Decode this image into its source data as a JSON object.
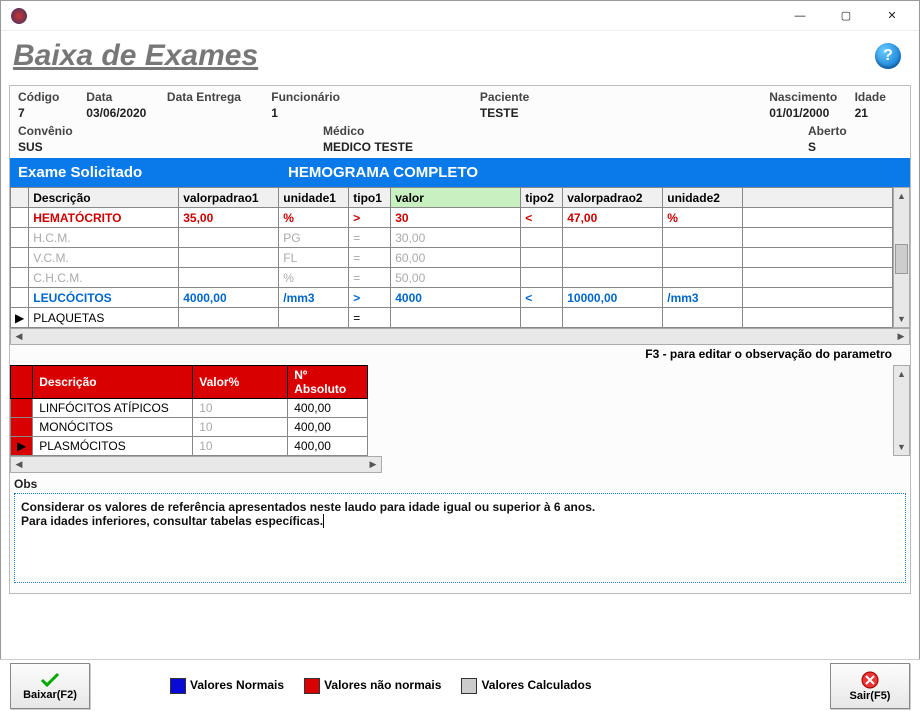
{
  "window": {
    "title": "Baixa de Exames"
  },
  "info": {
    "codigo_label": "Código",
    "codigo": "7",
    "data_label": "Data",
    "data": "03/06/2020",
    "entrega_label": "Data Entrega",
    "entrega": "",
    "funcionario_label": "Funcionário",
    "funcionario": "1",
    "paciente_label": "Paciente",
    "paciente": "TESTE",
    "nascimento_label": "Nascimento",
    "nascimento": "01/01/2000",
    "idade_label": "Idade",
    "idade": "21",
    "convenio_label": "Convênio",
    "convenio": "SUS",
    "medico_label": "Médico",
    "medico": "MEDICO TESTE",
    "aberto_label": "Aberto",
    "aberto": "S"
  },
  "exame": {
    "title": "Exame Solicitado",
    "name": "HEMOGRAMA COMPLETO",
    "headers": {
      "descricao": "Descrição",
      "vp1": "valorpadrao1",
      "u1": "unidade1",
      "t1": "tipo1",
      "valor": "valor",
      "t2": "tipo2",
      "vp2": "valorpadrao2",
      "u2": "unidade2"
    },
    "rows": [
      {
        "desc": "HEMATÓCRITO",
        "vp1": "35,00",
        "u1": "%",
        "t1": ">",
        "valor": "30",
        "t2": "<",
        "vp2": "47,00",
        "u2": "%",
        "cls": "c-red"
      },
      {
        "desc": "H.C.M.",
        "vp1": "",
        "u1": "PG",
        "t1": "=",
        "valor": "30,00",
        "t2": "",
        "vp2": "",
        "u2": "",
        "cls": "c-gray"
      },
      {
        "desc": "V.C.M.",
        "vp1": "",
        "u1": "FL",
        "t1": "=",
        "valor": "60,00",
        "t2": "",
        "vp2": "",
        "u2": "",
        "cls": "c-gray"
      },
      {
        "desc": "C.H.C.M.",
        "vp1": "",
        "u1": "%",
        "t1": "=",
        "valor": "50,00",
        "t2": "",
        "vp2": "",
        "u2": "",
        "cls": "c-gray"
      },
      {
        "desc": "LEUCÓCITOS",
        "vp1": "4000,00",
        "u1": "/mm3",
        "t1": ">",
        "valor": "4000",
        "t2": "<",
        "vp2": "10000,00",
        "u2": "/mm3",
        "cls": "c-blue"
      },
      {
        "desc": "PLAQUETAS",
        "vp1": "",
        "u1": "",
        "t1": "=",
        "valor": "",
        "t2": "",
        "vp2": "",
        "u2": "",
        "cls": ""
      }
    ]
  },
  "hint": "F3 - para editar o observação do parametro",
  "sub": {
    "headers": {
      "desc": "Descrição",
      "valpct": "Valor%",
      "nabs": "Nº Absoluto"
    },
    "rows": [
      {
        "desc": "LINFÓCITOS ATÍPICOS",
        "valpct": "10",
        "nabs": "400,00"
      },
      {
        "desc": "MONÓCITOS",
        "valpct": "10",
        "nabs": "400,00"
      },
      {
        "desc": "PLASMÓCITOS",
        "valpct": "10",
        "nabs": "400,00"
      }
    ]
  },
  "obs": {
    "label": "Obs",
    "text": "Considerar os valores de referência apresentados neste laudo para idade igual ou superior à 6 anos.\nPara idades inferiores, consultar tabelas específicas."
  },
  "footer": {
    "baixar": "Baixar(F2)",
    "sair": "Sair(F5)",
    "legend": {
      "normais": "Valores Normais",
      "nao_normais": "Valores não normais",
      "calculados": "Valores Calculados"
    }
  }
}
